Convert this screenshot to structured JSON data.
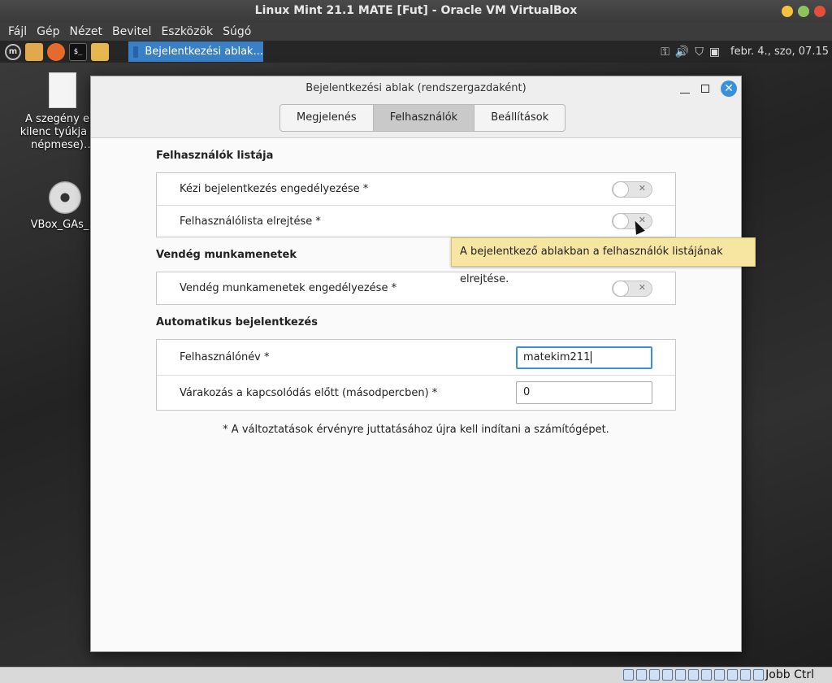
{
  "host": {
    "title": "Linux Mint 21.1 MATE [Fut] - Oracle VM VirtualBox",
    "menu": [
      "Fájl",
      "Gép",
      "Nézet",
      "Bevitel",
      "Eszközök",
      "Súgó"
    ],
    "host_key": "Jobb Ctrl"
  },
  "panel": {
    "taskbar_item": "Bejelentkezési ablak...",
    "clock": "febr. 4., szo, 07.15",
    "terminal_glyph": "$_",
    "menu_glyph": "m"
  },
  "desktop": {
    "icons": [
      {
        "label": "A szegény e… kilenc tyúkja (… népmese)…"
      },
      {
        "label": "VBox_GAs_…"
      }
    ]
  },
  "dialog": {
    "title": "Bejelentkezési ablak (rendszergazdaként)",
    "tabs": [
      "Megjelenés",
      "Felhasználók",
      "Beállítások"
    ],
    "active_tab": "Felhasználók",
    "sections": {
      "user_list": {
        "title": "Felhasználók listája",
        "manual_login": {
          "label": "Kézi bejelentkezés engedélyezése *",
          "enabled": false
        },
        "hide_user_list": {
          "label": "Felhasználólista elrejtése *",
          "enabled": false
        }
      },
      "guest": {
        "title": "Vendég munkamenetek",
        "allow_guest": {
          "label": "Vendég munkamenetek engedélyezése *",
          "enabled": false
        }
      },
      "autologin": {
        "title": "Automatikus bejelentkezés",
        "username": {
          "label": "Felhasználónév *",
          "value": "matekim211"
        },
        "delay": {
          "label": "Várakozás a kapcsolódás előtt (másodpercben) *",
          "value": "0"
        }
      }
    },
    "note": "* A változtatások érvényre juttatásához újra kell indítani a számítógépet.",
    "tooltip": "A bejelentkező ablakban a felhasználók listájának elrejtése."
  }
}
